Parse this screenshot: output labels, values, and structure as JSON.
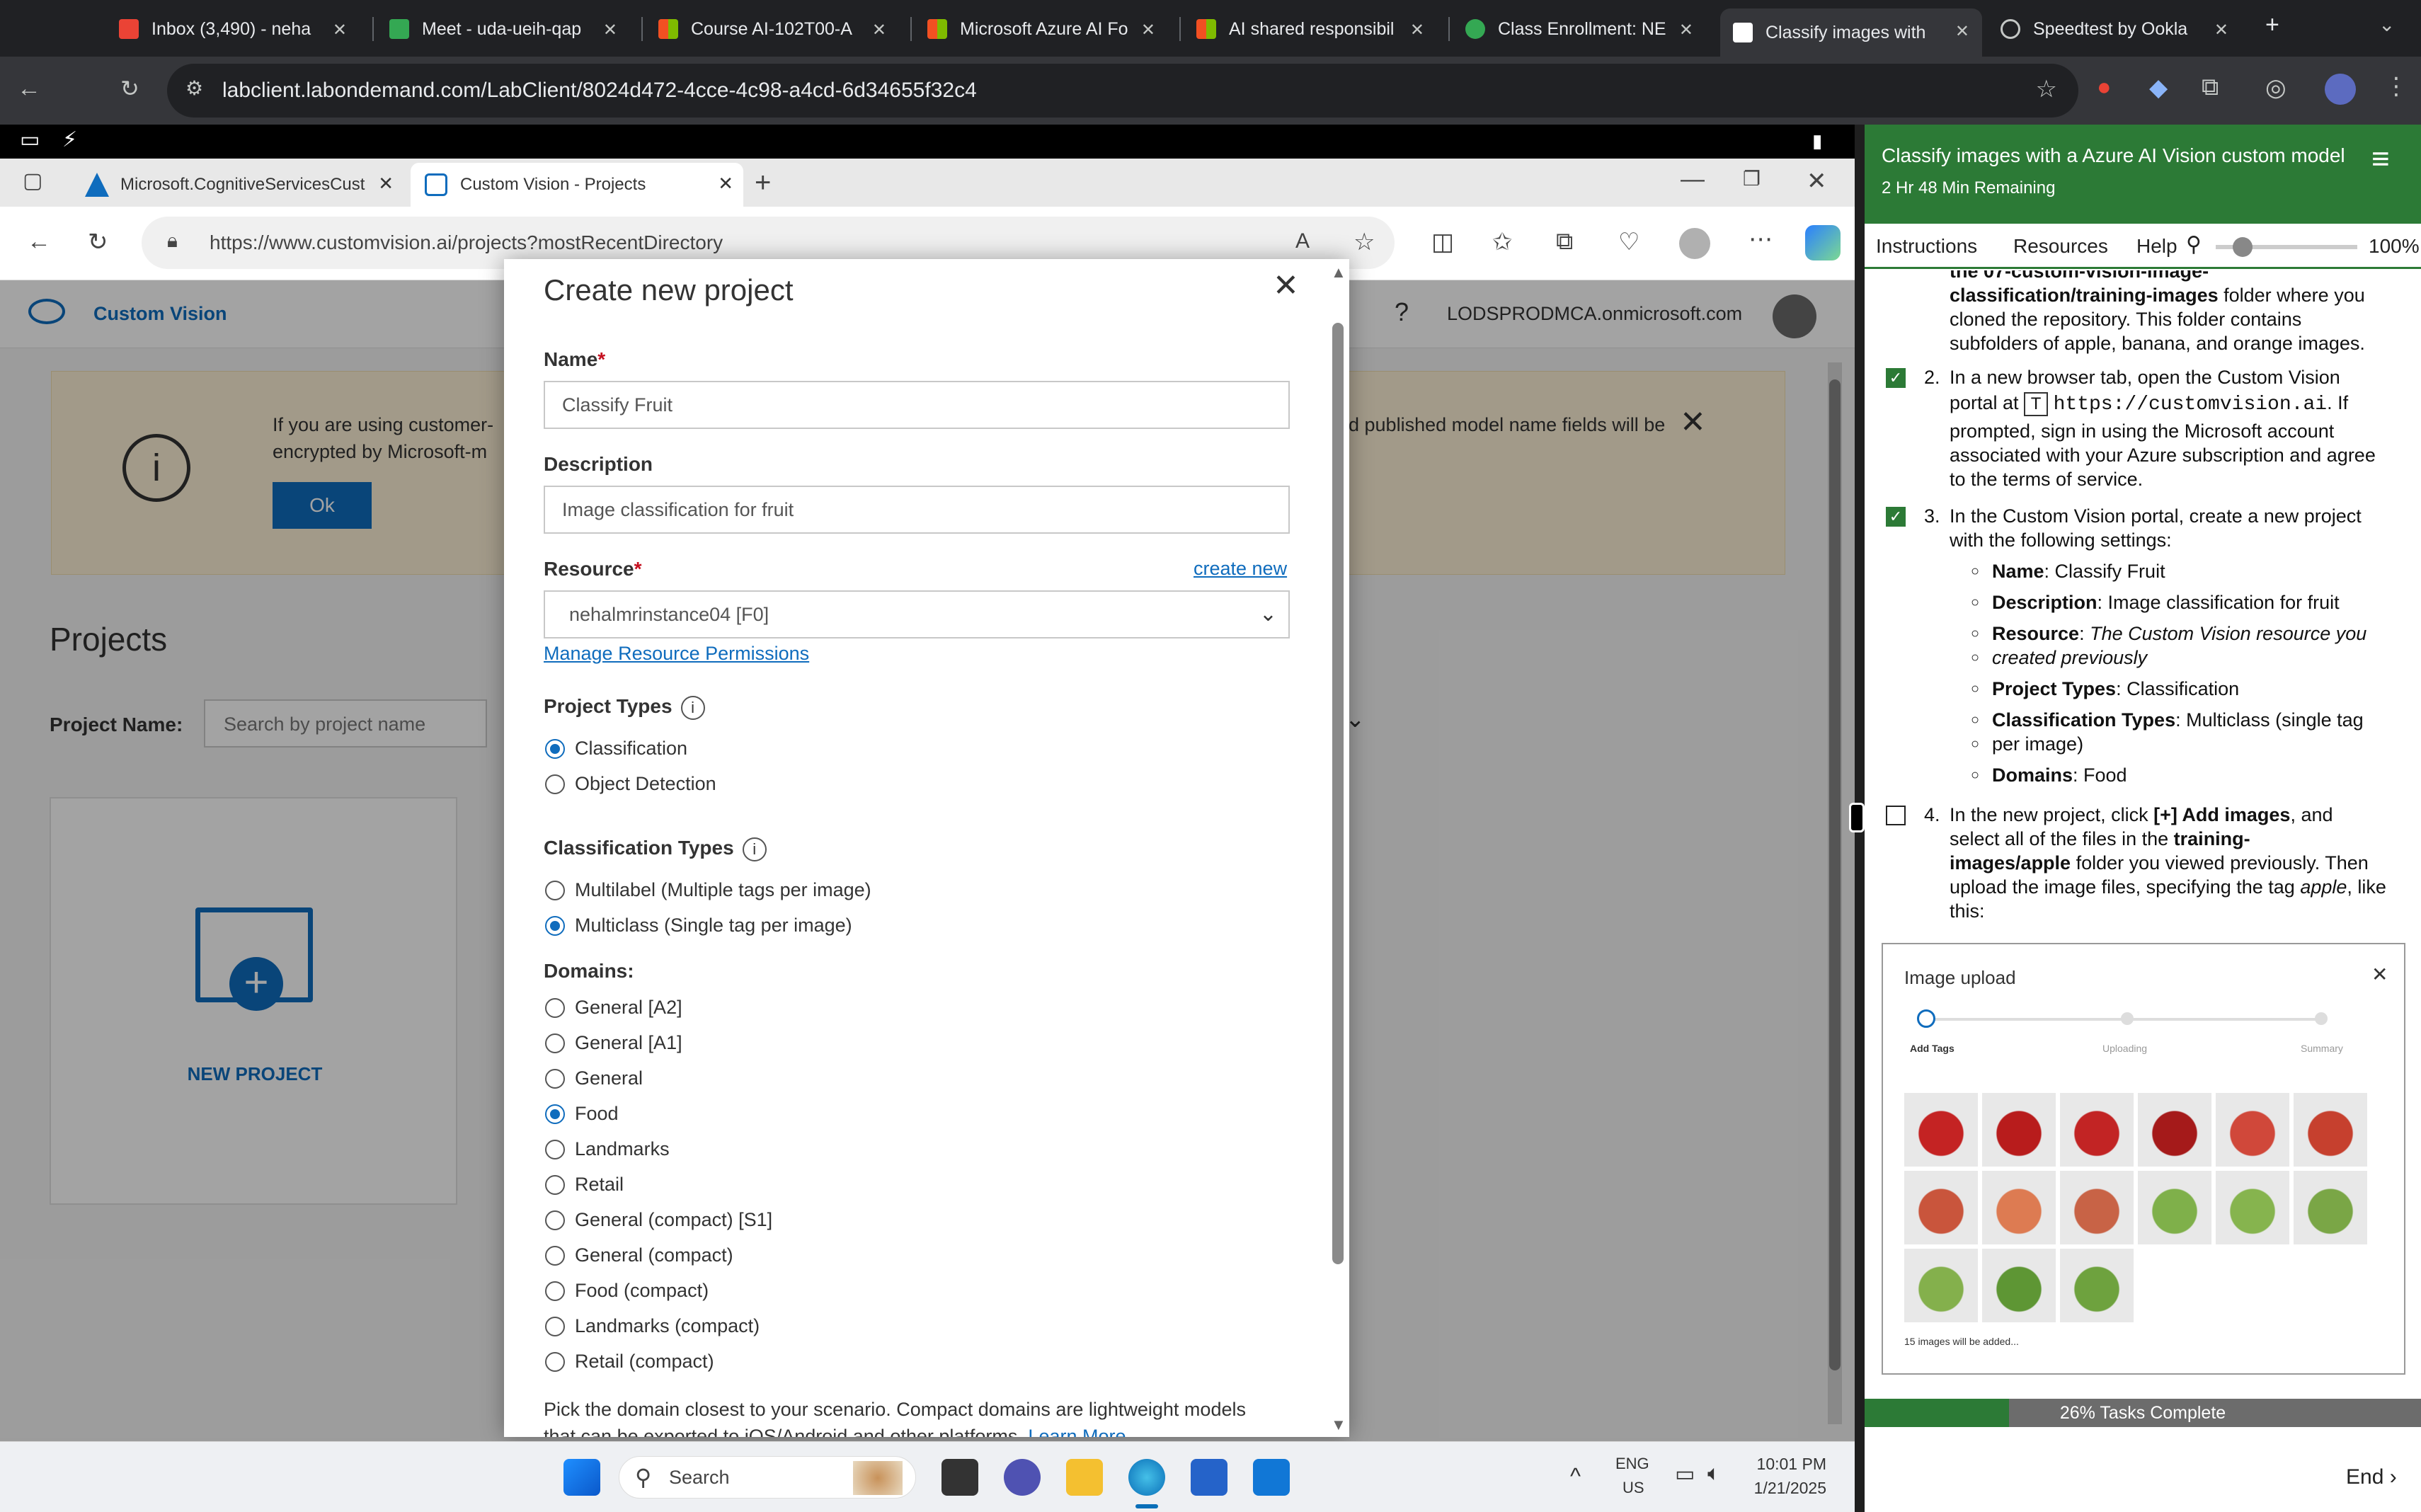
{
  "chrome": {
    "tabs": [
      {
        "label": "Inbox (3,490) - neha",
        "color": "#ea4335"
      },
      {
        "label": "Meet - uda-ueih-qap",
        "color": "#34a853"
      },
      {
        "label": "Course AI-102T00-A",
        "color": "#f25022"
      },
      {
        "label": "Microsoft Azure AI Fo",
        "color": "#f25022"
      },
      {
        "label": "AI shared responsibil",
        "color": "#f25022"
      },
      {
        "label": "Class Enrollment: NE",
        "color": "#34a853"
      },
      {
        "label": "Classify images with",
        "color": "#ffffff"
      },
      {
        "label": "Speedtest by Ookla",
        "color": "#c4c7c5"
      }
    ],
    "url": "labclient.labondemand.com/LabClient/8024d472-4cce-4c98-a4cd-6d34655f32c4"
  },
  "edge": {
    "tabs": [
      {
        "label": "Microsoft.CognitiveServicesCust"
      },
      {
        "label": "Custom Vision - Projects"
      }
    ],
    "url": "https://www.customvision.ai/projects?mostRecentDirectory"
  },
  "customvision": {
    "brand": "Custom Vision",
    "account": "LODSPRODMCA.onmicrosoft.com",
    "banner_text_1": "If you are using customer-",
    "banner_text_2": "encrypted by Microsoft-m",
    "banner_text_right": "d published model name fields will be",
    "ok_label": "Ok",
    "projects_title": "Projects",
    "project_name_label": "Project Name:",
    "search_placeholder": "Search by project name",
    "new_project_label": "NEW PROJECT"
  },
  "modal": {
    "title": "Create new project",
    "name_label": "Name",
    "name_value": "Classify Fruit",
    "description_label": "Description",
    "description_value": "Image classification for fruit",
    "resource_label": "Resource",
    "create_new": "create new",
    "resource_value": "nehalmrinstance04 [F0]",
    "manage_permissions": "Manage Resource Permissions",
    "project_types_label": "Project Types",
    "project_types": [
      "Classification",
      "Object Detection"
    ],
    "project_type_selected": "Classification",
    "classification_types_label": "Classification Types",
    "classification_types": [
      "Multilabel (Multiple tags per image)",
      "Multiclass (Single tag per image)"
    ],
    "classification_type_selected": "Multiclass (Single tag per image)",
    "domains_label": "Domains:",
    "domains": [
      "General [A2]",
      "General [A1]",
      "General",
      "Food",
      "Landmarks",
      "Retail",
      "General (compact) [S1]",
      "General (compact)",
      "Food (compact)",
      "Landmarks (compact)",
      "Retail (compact)"
    ],
    "domain_selected": "Food",
    "footer_text": "Pick the domain closest to your scenario. Compact domains are lightweight models",
    "footer_text_2": "that can be exported to iOS/Android and other platforms.",
    "learn_more": "Learn More"
  },
  "lab": {
    "title": "Classify images with a Azure AI Vision custom model",
    "remaining": "2 Hr 48 Min Remaining",
    "nav": {
      "instructions": "Instructions",
      "resources": "Resources",
      "help": "Help",
      "zoom": "100%"
    },
    "zoom_fraction": 0.12,
    "intro_1": "the 07-custom-vision-image-",
    "intro_2_bold": "classification/training-images",
    "intro_2_rest": " folder where you",
    "intro_3": "cloned the repository. This folder contains",
    "intro_4": "subfolders of apple, banana, and orange images.",
    "step2_num": "2.",
    "step2_a": "In a new browser tab, open the Custom Vision",
    "step2_b_pre": "portal at",
    "step2_code": "https://customvision.ai",
    "step2_b_post": ". If",
    "step2_c": "prompted, sign in using the Microsoft account",
    "step2_d": "associated with your Azure subscription and agree",
    "step2_e": "to the terms of service.",
    "step3_num": "3.",
    "step3_a": "In the Custom Vision portal, create a new project",
    "step3_b": "with the following settings:",
    "settings": [
      {
        "key": "Name",
        "val": ": Classify Fruit"
      },
      {
        "key": "Description",
        "val": ": Image classification for fruit"
      },
      {
        "key": "Resource",
        "val": ": "
      },
      {
        "key": "Project Types",
        "val": ": Classification"
      },
      {
        "key": "Classification Types",
        "val": ": Multiclass (single tag"
      },
      {
        "key": "Domains",
        "val": ": Food"
      }
    ],
    "resource_italic_1": "The Custom Vision resource you",
    "resource_italic_2": "created previously",
    "classtype_cont": "per image)",
    "step4_num": "4.",
    "step4_a_pre": "In the new project, click ",
    "step4_a_bold": "[+] Add images",
    "step4_a_post": ", and",
    "step4_b_pre": "select all of the files in the ",
    "step4_b_bold": "training-",
    "step4_c_bold": "images/apple",
    "step4_c_post": " folder you viewed previously. Then",
    "step4_d": "upload the image files, specifying the tag",
    "step4_d_italic": "apple",
    "step4_d_post": ", like",
    "step4_e": "this:",
    "upload_title": "Image upload",
    "upload_steps": [
      "Add Tags",
      "Uploading",
      "Summary"
    ],
    "upload_count": "15 images will be added...",
    "progress_text": "26% Tasks Complete",
    "progress_fraction": 0.26,
    "end_label": "End"
  },
  "taskbar": {
    "search": "Search",
    "lang_1": "ENG",
    "lang_2": "US",
    "time": "10:01 PM",
    "date": "1/21/2025"
  }
}
